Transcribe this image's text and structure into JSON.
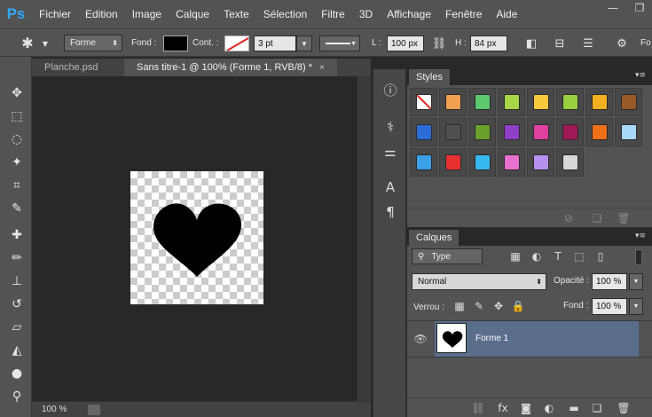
{
  "app": {
    "logo": "Ps"
  },
  "menu": [
    "Fichier",
    "Edition",
    "Image",
    "Calque",
    "Texte",
    "Sélection",
    "Filtre",
    "3D",
    "Affichage",
    "Fenêtre",
    "Aide"
  ],
  "options": {
    "mode_value": "Forme",
    "fill_label": "Fond :",
    "stroke_label": "Cont. :",
    "stroke_width": "3 pt",
    "w_label": "L :",
    "w_value": "100 px",
    "h_label": "H :",
    "h_value": "84 px",
    "fo_label": "Fo"
  },
  "tabs": [
    {
      "label": "Planche.psd",
      "close": "×"
    },
    {
      "label": "Sans titre-1 @ 100% (Forme 1, RVB/8) *",
      "close": "×"
    }
  ],
  "status": {
    "zoom": "100 %"
  },
  "styles_panel": {
    "tab": "Styles",
    "swatches": [
      [
        "#ffffff",
        "#f0a050",
        "#5cc870",
        "#a8d848",
        "#f6c83c",
        "#98d040",
        "#f2b020",
        "#9a5a28"
      ],
      [
        "#2c6cd8",
        "#505050",
        "#6aa02c",
        "#9040c8",
        "#e040a0",
        "#a01858",
        "#f07018",
        "#a8d8f8"
      ],
      [
        "#3aa0e8",
        "#e83030",
        "#38b8f0",
        "#e870d0",
        "#b890f0",
        "#d8d8d8"
      ]
    ]
  },
  "layers_panel": {
    "tab": "Calques",
    "filter_value": "Type",
    "blend_mode": "Normal",
    "opacity_label": "Opacité :",
    "opacity_value": "100 %",
    "lock_label": "Verrou :",
    "fill_label": "Fond :",
    "fill_value": "100 %",
    "layers": [
      {
        "name": "Forme 1",
        "selected": true
      }
    ]
  },
  "colors": {
    "accent": "#31a8ff",
    "selected_layer": "#5a6e8c"
  }
}
